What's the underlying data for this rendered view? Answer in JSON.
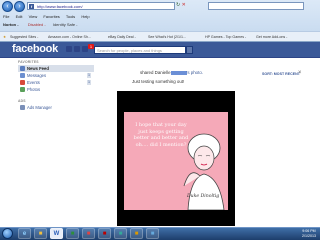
{
  "browser": {
    "address": "http://www.facebook.com/",
    "menu": [
      "File",
      "Edit",
      "View",
      "Favorites",
      "Tools",
      "Help"
    ],
    "toolbar": {
      "norton": "Norton -",
      "disabled": "Disabled -",
      "identity": "Identity Safe -"
    },
    "favorites_bar": [
      {
        "label": "Suggested Sites -"
      },
      {
        "label": "Amazon.com - Online Sh..."
      },
      {
        "label": "eBay Daily Deal -"
      },
      {
        "label": "See What's Hot (2/1/1..."
      },
      {
        "label": "HP Games - Top Games -"
      },
      {
        "label": "Get more Add-ons -"
      }
    ]
  },
  "facebook": {
    "logo": "facebook",
    "search_placeholder": "Search for people, places and things",
    "notification_count": "1",
    "sidebar": {
      "favorites_heading": "FAVORITES",
      "items": [
        {
          "label": "News Feed",
          "active": true,
          "icon": "news-feed-icon",
          "color": "#5a7dbe"
        },
        {
          "label": "Messages",
          "count": "1",
          "icon": "messages-icon",
          "color": "#6c8fd0"
        },
        {
          "label": "Events",
          "count": "1",
          "icon": "events-icon",
          "color": "#d84a3a"
        },
        {
          "label": "Photos",
          "icon": "photos-icon",
          "color": "#5aa05a"
        }
      ],
      "ads_heading": "ADS",
      "ads_items": [
        {
          "label": "Ads Manager",
          "icon": "ads-manager-icon",
          "color": "#7a8fb8"
        }
      ]
    },
    "story": {
      "action": "shared Danielle",
      "photo_suffix": "'s photo.",
      "sort": "SORT: MOST RECENT",
      "caption": "Just testing something out!",
      "ecard_text": "I hope that your day just keeps getting better and better and oh.... did I mention?",
      "ecard_brand": "Duke Dinoltig"
    }
  },
  "taskbar": {
    "apps": [
      "e",
      "■",
      "W",
      "■",
      "■",
      "■",
      "■",
      "■",
      "■"
    ],
    "time": "9:06 PM",
    "date": "2/1/2013"
  }
}
